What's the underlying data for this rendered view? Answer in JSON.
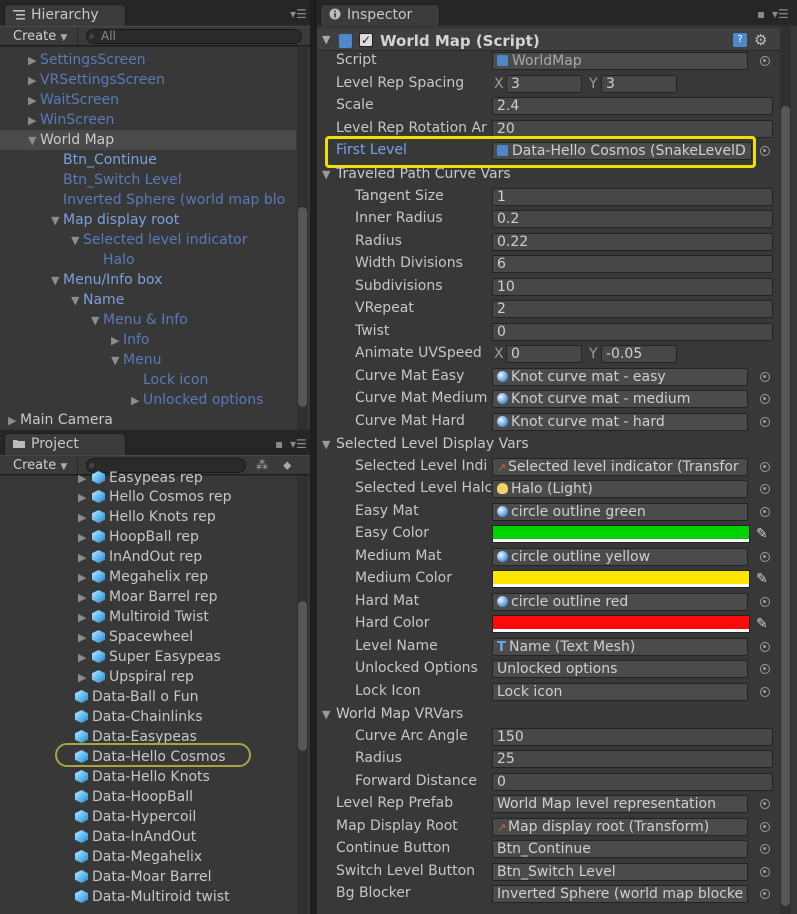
{
  "hierarchy": {
    "tab_label": "Hierarchy",
    "create_label": "Create",
    "search_placeholder": "All",
    "items": [
      {
        "label": "SettingsScreen"
      },
      {
        "label": "VRSettingsScreen"
      },
      {
        "label": "WaitScreen"
      },
      {
        "label": "WinScreen"
      },
      {
        "label": "World Map"
      },
      {
        "label": "Btn_Continue"
      },
      {
        "label": "Btn_Switch Level"
      },
      {
        "label": "Inverted Sphere (world map blo"
      },
      {
        "label": "Map display root"
      },
      {
        "label": "Selected level indicator"
      },
      {
        "label": "Halo"
      },
      {
        "label": "Menu/Info box"
      },
      {
        "label": "Name"
      },
      {
        "label": "Menu & Info"
      },
      {
        "label": "Info"
      },
      {
        "label": "Menu"
      },
      {
        "label": "Lock icon"
      },
      {
        "label": "Unlocked options"
      },
      {
        "label": "Main Camera"
      }
    ]
  },
  "project": {
    "tab_label": "Project",
    "create_label": "Create",
    "items": [
      {
        "label": "Easypeas rep"
      },
      {
        "label": "Hello Cosmos rep"
      },
      {
        "label": "Hello Knots rep"
      },
      {
        "label": "HoopBall rep"
      },
      {
        "label": "InAndOut rep"
      },
      {
        "label": "Megahelix rep"
      },
      {
        "label": "Moar Barrel rep"
      },
      {
        "label": "Multiroid Twist"
      },
      {
        "label": "Spacewheel"
      },
      {
        "label": "Super Easypeas"
      },
      {
        "label": "Upspiral rep"
      },
      {
        "label": "Data-Ball o Fun"
      },
      {
        "label": "Data-Chainlinks"
      },
      {
        "label": "Data-Easypeas"
      },
      {
        "label": "Data-Hello Cosmos"
      },
      {
        "label": "Data-Hello Knots"
      },
      {
        "label": "Data-HoopBall"
      },
      {
        "label": "Data-Hypercoil"
      },
      {
        "label": "Data-InAndOut"
      },
      {
        "label": "Data-Megahelix"
      },
      {
        "label": "Data-Moar Barrel"
      },
      {
        "label": "Data-Multiroid twist"
      }
    ]
  },
  "inspector": {
    "tab_label": "Inspector",
    "component_title": "World Map (Script)",
    "rows": {
      "script": {
        "label": "Script",
        "value": "WorldMap"
      },
      "level_rep_spacing": {
        "label": "Level Rep Spacing",
        "x_label": "X",
        "x": "3",
        "y_label": "Y",
        "y": "3"
      },
      "scale": {
        "label": "Scale",
        "value": "2.4"
      },
      "level_rep_rotation": {
        "label": "Level Rep Rotation Ar",
        "value": "20"
      },
      "first_level": {
        "label": "First Level",
        "value": "Data-Hello Cosmos (SnakeLevelD"
      },
      "traveled_header": {
        "label": "Traveled Path Curve Vars"
      },
      "tangent_size": {
        "label": "Tangent Size",
        "value": "1"
      },
      "inner_radius": {
        "label": "Inner Radius",
        "value": "0.2"
      },
      "radius": {
        "label": "Radius",
        "value": "0.22"
      },
      "width_divisions": {
        "label": "Width Divisions",
        "value": "6"
      },
      "subdivisions": {
        "label": "Subdivisions",
        "value": "10"
      },
      "vrepeat": {
        "label": "VRepeat",
        "value": "2"
      },
      "twist": {
        "label": "Twist",
        "value": "0"
      },
      "animate_uvspeed": {
        "label": "Animate UVSpeed",
        "x_label": "X",
        "x": "0",
        "y_label": "Y",
        "y": "-0.05"
      },
      "curve_mat_easy": {
        "label": "Curve Mat Easy",
        "value": "Knot curve mat - easy"
      },
      "curve_mat_medium": {
        "label": "Curve Mat Medium",
        "value": "Knot curve mat - medium"
      },
      "curve_mat_hard": {
        "label": "Curve Mat Hard",
        "value": "Knot curve mat - hard"
      },
      "selected_header": {
        "label": "Selected Level Display Vars"
      },
      "selected_level_indi": {
        "label": "Selected Level Indi",
        "value": "Selected level indicator (Transfor"
      },
      "selected_level_halo": {
        "label": "Selected Level Halc",
        "value": "Halo (Light)"
      },
      "easy_mat": {
        "label": "Easy Mat",
        "value": "circle outline green"
      },
      "easy_color": {
        "label": "Easy Color",
        "color": "#00d200"
      },
      "medium_mat": {
        "label": "Medium Mat",
        "value": "circle outline yellow"
      },
      "medium_color": {
        "label": "Medium Color",
        "color": "#ffe600"
      },
      "hard_mat": {
        "label": "Hard Mat",
        "value": "circle outline red"
      },
      "hard_color": {
        "label": "Hard Color",
        "color": "#ff0a0a"
      },
      "level_name": {
        "label": "Level Name",
        "value": "Name (Text Mesh)"
      },
      "unlocked_options": {
        "label": "Unlocked Options",
        "value": "Unlocked options"
      },
      "lock_icon": {
        "label": "Lock Icon",
        "value": "Lock icon"
      },
      "vrvars_header": {
        "label": "World Map VRVars"
      },
      "curve_arc_angle": {
        "label": "Curve Arc Angle",
        "value": "150"
      },
      "vr_radius": {
        "label": "Radius",
        "value": "25"
      },
      "forward_distance": {
        "label": "Forward Distance",
        "value": "0"
      },
      "level_rep_prefab": {
        "label": "Level Rep Prefab",
        "value": "World Map level representation"
      },
      "map_display_root": {
        "label": "Map Display Root",
        "value": "Map display root (Transform)"
      },
      "continue_button": {
        "label": "Continue Button",
        "value": "Btn_Continue"
      },
      "switch_level_button": {
        "label": "Switch Level Button",
        "value": "Btn_Switch Level"
      },
      "bg_blocker": {
        "label": "Bg Blocker",
        "value": "Inverted Sphere (world map blocke"
      }
    }
  },
  "colors": {
    "highlight_yellow": "#f0e000",
    "selection_blue": "#5b79b8"
  }
}
